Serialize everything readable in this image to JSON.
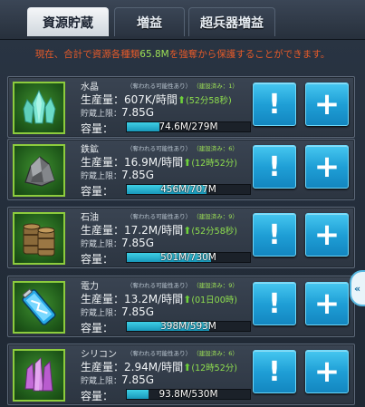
{
  "tabs": [
    {
      "label": "資源貯蔵",
      "active": true
    },
    {
      "label": "増益",
      "active": false
    },
    {
      "label": "超兵器増益",
      "active": false
    }
  ],
  "notice": {
    "prefix": "現在、合計で資源各種類",
    "amount": "65.8M",
    "suffix": "を強奪から保護することができます。"
  },
  "labels": {
    "protected_tag": "（奪われる可能性あり）",
    "production": "生産量：",
    "storage_limit": "貯蔵上限：",
    "capacity": "容量：",
    "info_button": "!",
    "add_button": "+",
    "side_handle": "«"
  },
  "resources": [
    {
      "name": "水晶",
      "built": "（建設済み：1）",
      "production": "607K/時間",
      "time": "(52分58秒)",
      "limit": "7.85G",
      "capacity": "74.6M/279M",
      "fill_fraction": 0.267,
      "icon": "crystal-icon"
    },
    {
      "name": "鉄鉱",
      "built": "（建設済み：6）",
      "production": "16.9M/時間",
      "time": "(12時52分)",
      "limit": "7.85G",
      "capacity": "456M/707M",
      "fill_fraction": 0.645,
      "icon": "iron-ore-icon"
    },
    {
      "name": "石油",
      "built": "（建設済み：9）",
      "production": "17.2M/時間",
      "time": "(52分58秒)",
      "limit": "7.85G",
      "capacity": "501M/730M",
      "fill_fraction": 0.686,
      "icon": "oil-barrel-icon"
    },
    {
      "name": "電力",
      "built": "（建設済み：9）",
      "production": "13.2M/時間",
      "time": "(01日00時)",
      "limit": "7.85G",
      "capacity": "398M/593M",
      "fill_fraction": 0.671,
      "icon": "battery-icon"
    },
    {
      "name": "シリコン",
      "built": "（建設済み：6）",
      "production": "2.94M/時間",
      "time": "(12時52分)",
      "limit": "7.85G",
      "capacity": "93.8M/530M",
      "fill_fraction": 0.177,
      "icon": "silicon-icon"
    }
  ]
}
